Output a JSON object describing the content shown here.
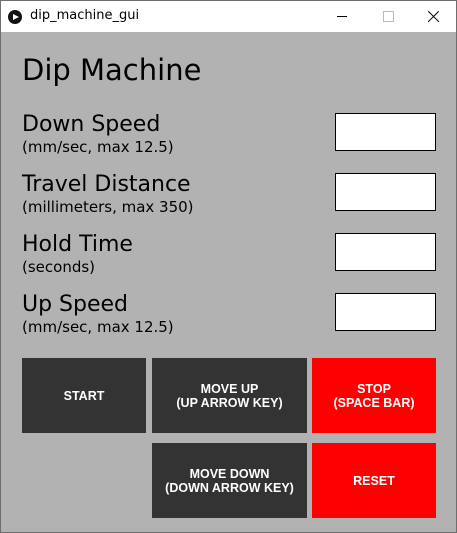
{
  "window": {
    "title": "dip_machine_gui"
  },
  "app": {
    "title": "Dip Machine"
  },
  "fields": [
    {
      "label": "Down Speed",
      "hint": "(mm/sec, max 12.5)",
      "value": ""
    },
    {
      "label": "Travel Distance",
      "hint": "(millimeters, max 350)",
      "value": ""
    },
    {
      "label": "Hold Time",
      "hint": "(seconds)",
      "value": ""
    },
    {
      "label": "Up Speed",
      "hint": "(mm/sec, max 12.5)",
      "value": ""
    }
  ],
  "buttons": {
    "start": "START",
    "move_up": "MOVE UP\n(UP ARROW KEY)",
    "stop": "STOP\n(SPACE BAR)",
    "move_down": "MOVE DOWN\n(DOWN ARROW KEY)",
    "reset": "RESET"
  },
  "colors": {
    "background": "#b2b2b2",
    "dark_button": "#333333",
    "danger_button": "#ff0000",
    "button_text": "#ffffff"
  }
}
